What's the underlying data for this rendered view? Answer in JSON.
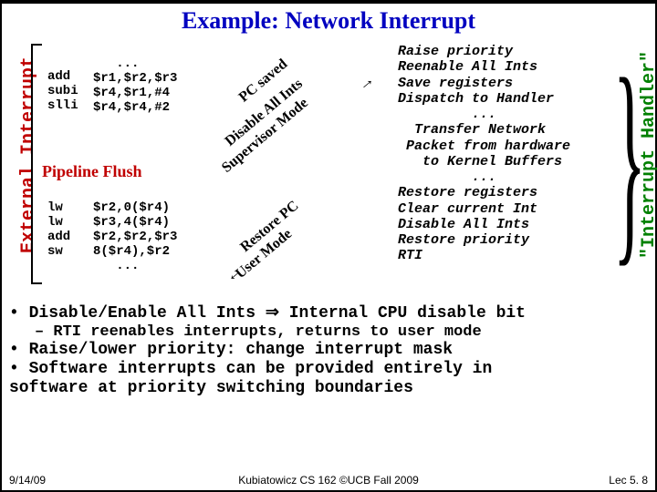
{
  "title": "Example: Network Interrupt",
  "left_label": "External Interrupt",
  "right_label": "\"Interrupt Handler\"",
  "code1_left": "add\nsubi\nslli",
  "code1_right": "   ...\n$r1,$r2,$r3\n$r4,$r1,#4\n$r4,$r4,#2",
  "pipeline": "Pipeline Flush",
  "code2_left": "lw\nlw\nadd\nsw",
  "code2_right": "$r2,0($r4)\n$r3,4($r4)\n$r2,$r2,$r3\n8($r4),$r2\n   ...",
  "rot1a": "PC saved",
  "rot1b": "Disable All Ints",
  "rot1c": "Supervisor Mode",
  "rot2a": "Restore PC",
  "rot2b": "User Mode",
  "handler": {
    "l1": "Raise priority",
    "l2": "Reenable All Ints",
    "l3": "Save registers",
    "l4": "Dispatch to Handler",
    "l5": "         ...",
    "l6": "  Transfer Network",
    "l7": " Packet from hardware",
    "l8": "   to Kernel Buffers",
    "l9": "         ...",
    "l10": "Restore registers",
    "l11": "Clear current Int",
    "l12": "Disable All Ints",
    "l13": "Restore priority",
    "l14": "RTI"
  },
  "bullets": {
    "b1": "• Disable/Enable All Ints ⇒ Internal CPU disable bit",
    "b2": "– RTI reenables interrupts, returns to user mode",
    "b3": "• Raise/lower priority: change interrupt mask",
    "b4": "• Software interrupts can be provided entirely in",
    "b5": "  software at priority switching boundaries"
  },
  "footer": {
    "date": "9/14/09",
    "center": "Kubiatowicz CS 162 ©UCB Fall 2009",
    "right": "Lec 5. 8"
  }
}
